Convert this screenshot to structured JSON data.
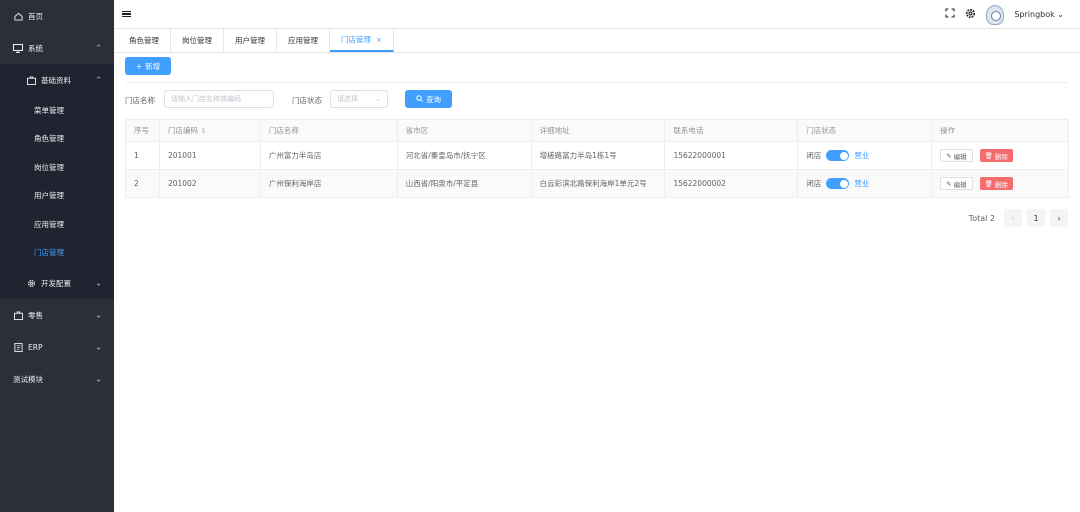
{
  "sidebar": {
    "items": [
      {
        "label": "首页",
        "icon": "home-icon"
      },
      {
        "label": "系统",
        "icon": "monitor-icon"
      },
      {
        "label": "基础资料",
        "icon": "briefcase-icon"
      },
      {
        "label": "菜单管理"
      },
      {
        "label": "角色管理"
      },
      {
        "label": "岗位管理"
      },
      {
        "label": "用户管理"
      },
      {
        "label": "应用管理"
      },
      {
        "label": "门店管理"
      },
      {
        "label": "开发配置",
        "icon": "gear-icon"
      },
      {
        "label": "零售",
        "icon": "briefcase-icon"
      },
      {
        "label": "ERP",
        "icon": "document-icon"
      },
      {
        "label": "测试模块"
      }
    ],
    "active_color": "#409eff"
  },
  "header": {
    "username": "Springbok"
  },
  "tabs": [
    {
      "label": "角色管理"
    },
    {
      "label": "岗位管理"
    },
    {
      "label": "用户管理"
    },
    {
      "label": "应用管理"
    },
    {
      "label": "门店管理",
      "close": "×"
    }
  ],
  "toolbar": {
    "add_label": "新增"
  },
  "filters": {
    "name_label": "门店名称",
    "name_placeholder": "请输入门店名称或编码",
    "status_label": "门店状态",
    "status_placeholder": "请选择",
    "search_label": "查询"
  },
  "table": {
    "headers": [
      "序号",
      "门店编码",
      "门店名称",
      "省市区",
      "详细地址",
      "联系电话",
      "门店状态",
      "操作"
    ],
    "rows": [
      {
        "idx": "1",
        "code": "201001",
        "name": "广州富力半岛店",
        "area": "河北省/秦皇岛市/抚宁区",
        "address": "增槎路富力半岛1栋1号",
        "phone": "15622000001",
        "off": "闭店",
        "on": "营业",
        "edit": "编辑",
        "delete": "删除"
      },
      {
        "idx": "2",
        "code": "201002",
        "name": "广州保利海岸店",
        "area": "山西省/阳泉市/平定县",
        "address": "白云彩滨北路保利海岸1单元2号",
        "phone": "15622000002",
        "off": "闭店",
        "on": "营业",
        "edit": "编辑",
        "delete": "删除"
      }
    ]
  },
  "pagination": {
    "total": "Total 2",
    "page": "1"
  }
}
